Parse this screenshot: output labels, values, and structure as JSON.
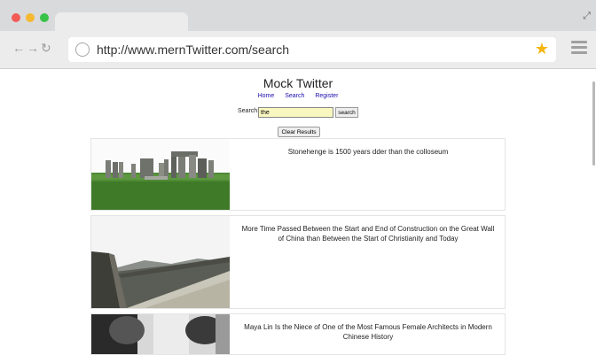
{
  "browser": {
    "url": "http://www.mernTwitter.com/search"
  },
  "app": {
    "title": "Mock Twitter",
    "nav": [
      "Home",
      "Search",
      "Register"
    ],
    "search": {
      "label": "Search:",
      "value": "the",
      "button": "search"
    },
    "clear_button": "Clear Results"
  },
  "results": [
    {
      "text": "Stonehenge is 1500 years dder than the colloseum",
      "image": "stonehenge-photo"
    },
    {
      "text": "More Time Passed Between the Start and End of Construction on the Great Wall of China than Between the Start of Christianity and Today",
      "image": "great-wall-photo"
    },
    {
      "text": "Maya Lin Is the Niece of One of the Most Famous Female Architects in Modern Chinese History",
      "image": "maya-lin-photo"
    }
  ],
  "colors": {
    "link": "#1a0dab",
    "search_highlight": "#f9f7c0",
    "star": "#f5b50d"
  }
}
